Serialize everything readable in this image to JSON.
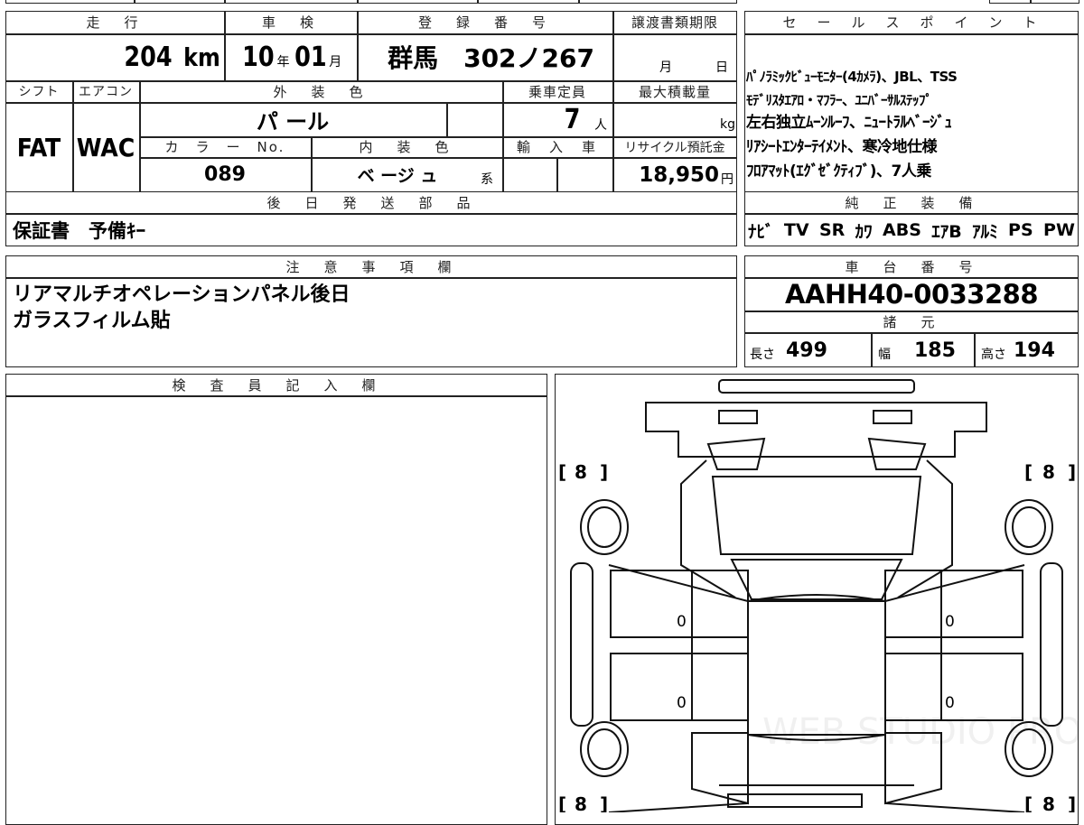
{
  "top_table": {
    "headers": {
      "mileage": "走　行",
      "inspection": "車　検",
      "registration": "登　録　番　号",
      "transfer_deadline": "譲渡書類期限",
      "shift": "シフト",
      "aircon": "エアコン",
      "exterior_color": "外　装　色",
      "capacity": "乗車定員",
      "max_load": "最大積載量",
      "color_no": "カ　ラ　ー　No.",
      "interior_color": "内　装　色",
      "import": "輸　入　車",
      "recycle_fee": "リサイクル預託金"
    },
    "mileage_value": "204",
    "mileage_unit": "km",
    "inspection_year": "10",
    "inspection_year_unit": "年",
    "inspection_month": "01",
    "inspection_month_unit": "月",
    "registration_value": "群馬　302ノ267",
    "deadline_month_unit": "月",
    "deadline_day_unit": "日",
    "shift_value": "FAT",
    "aircon_value": "WAC",
    "exterior_color_value": "パ ール",
    "capacity_value": "7",
    "capacity_unit": "人",
    "max_load_unit": "kg",
    "color_no_value": "089",
    "interior_color_value": "ベ ージ ュ",
    "interior_suffix": "系",
    "recycle_value": "18,950",
    "recycle_unit": "円"
  },
  "later_parts": {
    "header": "後　日　発　送　部　品",
    "value": "保証書　予備ｷｰ"
  },
  "sales_points": {
    "header": "セ　ー　ル　ス　ポ　イ　ン　ト",
    "lines": [
      "ﾊﾟﾉﾗﾐｯｸﾋﾞｭｰﾓﾆﾀｰ(4ｶﾒﾗ)、JBL、TSS",
      "ﾓﾃﾞﾘｽﾀｴｱﾛ・ﾏﾌﾗｰ、ﾕﾆﾊﾞｰｻﾙｽﾃｯﾌﾟ",
      "左右独立ﾑｰﾝﾙｰﾌ、ﾆｭｰﾄﾗﾙﾍﾞｰｼﾞｭ",
      "ﾘｱｼｰﾄｴﾝﾀｰﾃｲﾒﾝﾄ、寒冷地仕様",
      "ﾌﾛｱﾏｯﾄ(ｴｸﾞｾﾞｸﾃｨﾌﾞ)、7人乗"
    ]
  },
  "genuine_equipment": {
    "header": "純　正　装　備",
    "items": [
      "ﾅﾋﾞ",
      "TV",
      "SR",
      "ｶﾜ",
      "ABS",
      "ｴｱB",
      "ｱﾙﾐ",
      "PS",
      "PW"
    ]
  },
  "notes": {
    "header": "注　意　事　項　欄",
    "lines": [
      "リアマルチオペレーションパネル後日",
      "ガラスフィルム貼"
    ]
  },
  "chassis": {
    "header": "車　台　番　号",
    "value": "AAHH40-0033288"
  },
  "specs": {
    "header": "諸　元",
    "length_label": "長さ",
    "length_value": "499",
    "width_label": "幅",
    "width_value": "185",
    "height_label": "高さ",
    "height_value": "194"
  },
  "inspector": {
    "header": "検　査　員　記　入　欄"
  },
  "diagram": {
    "tire_front_left": "8",
    "tire_front_right": "8",
    "tire_rear_left": "8",
    "tire_rear_right": "8",
    "door_front_left": "0",
    "door_front_right": "0",
    "door_rear_left": "0",
    "door_rear_right": "0"
  },
  "watermark": "WEB STUDIO PRO"
}
